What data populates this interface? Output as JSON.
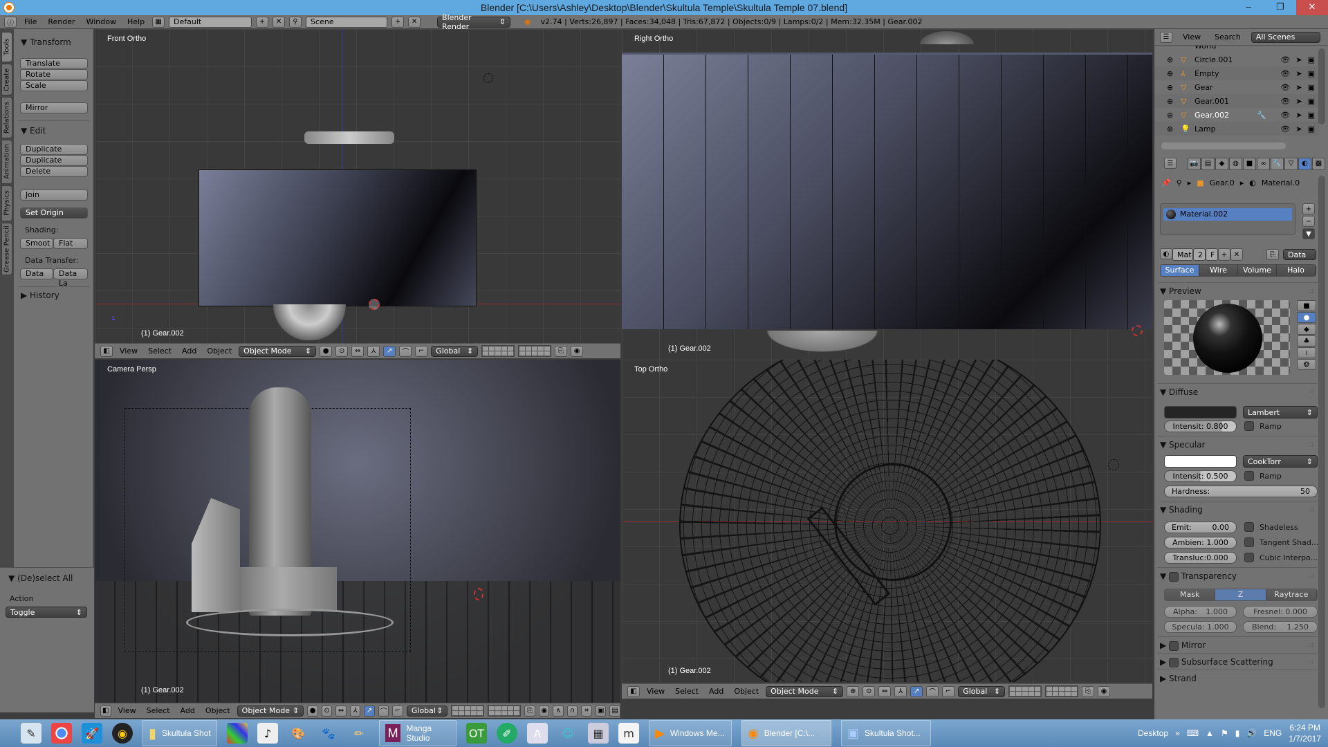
{
  "window": {
    "title": "Blender [C:\\Users\\Ashley\\Desktop\\Blender\\Skultula Temple\\Skultula Temple 07.blend]",
    "controls": {
      "minimize": "–",
      "maximize": "❐",
      "close": "✕"
    }
  },
  "topbar": {
    "menus": [
      "File",
      "Render",
      "Window",
      "Help"
    ],
    "layout": "Default",
    "scene": "Scene",
    "render_engine": "Blender Render",
    "stats": "v2.74 | Verts:26,897 | Faces:34,048 | Tris:67,872 | Objects:0/9 | Lamps:0/2 | Mem:32.35M | Gear.002"
  },
  "toolshelf": {
    "tabs": [
      "Tools",
      "Create",
      "Relations",
      "Animation",
      "Physics",
      "Grease Pencil"
    ],
    "active_tab": "Tools",
    "transform": {
      "title": "Transform",
      "buttons": [
        "Translate",
        "Rotate",
        "Scale",
        "Mirror"
      ]
    },
    "edit": {
      "title": "Edit",
      "buttons": [
        "Duplicate",
        "Duplicate Linked",
        "Delete",
        "Join"
      ],
      "set_origin": "Set Origin"
    },
    "shading": {
      "label": "Shading:",
      "smooth": "Smoot",
      "flat": "Flat"
    },
    "data_transfer": {
      "label": "Data Transfer:",
      "data": "Data",
      "data_layers": "Data La"
    },
    "history": "History"
  },
  "operator": {
    "title": "(De)select All",
    "action_label": "Action",
    "action_value": "Toggle"
  },
  "viewports": [
    {
      "label": "Front Ortho",
      "object": "(1) Gear.002",
      "axes": [
        "z",
        "x"
      ]
    },
    {
      "label": "Right Ortho",
      "object": "(1) Gear.002",
      "axes": [
        "z",
        "y"
      ]
    },
    {
      "label": "Camera Persp",
      "object": "(1) Gear.002",
      "axes": [
        "z",
        "x",
        "y"
      ]
    },
    {
      "label": "Top Ortho",
      "object": "(1) Gear.002",
      "axes": [
        "y",
        "x"
      ]
    }
  ],
  "viewport_header": {
    "menus": [
      "View",
      "Select",
      "Add",
      "Object"
    ],
    "mode": "Object Mode",
    "orientation": "Global"
  },
  "outliner": {
    "menus": [
      "View",
      "Search"
    ],
    "filter": "All Scenes",
    "partial_row": "World",
    "items": [
      {
        "name": "Circle.001",
        "icon": "mesh-icon",
        "selected": false
      },
      {
        "name": "Empty",
        "icon": "empty-icon",
        "selected": false
      },
      {
        "name": "Gear",
        "icon": "mesh-icon",
        "selected": false
      },
      {
        "name": "Gear.001",
        "icon": "mesh-icon",
        "selected": false
      },
      {
        "name": "Gear.002",
        "icon": "mesh-icon",
        "selected": true
      },
      {
        "name": "Lamp",
        "icon": "lamp-icon",
        "selected": false
      }
    ]
  },
  "properties": {
    "breadcrumb": [
      "Gear.0",
      "Material.0"
    ],
    "material_slot": "Material.002",
    "mat_name": "Mat",
    "users": "2",
    "fake": "F",
    "link": "Data",
    "type_tabs": [
      "Surface",
      "Wire",
      "Volume",
      "Halo"
    ],
    "active_type": "Surface",
    "preview": {
      "title": "Preview"
    },
    "diffuse": {
      "title": "Diffuse",
      "color": "#252525",
      "shader": "Lambert",
      "intensity_label": "Intensit:",
      "intensity": "0.800",
      "intensity_fraction": 0.8,
      "ramp": "Ramp"
    },
    "specular": {
      "title": "Specular",
      "color": "#ffffff",
      "shader": "CookTorr",
      "intensity_label": "Intensit:",
      "intensity": "0.500",
      "intensity_fraction": 0.5,
      "ramp": "Ramp",
      "hardness_label": "Hardness:",
      "hardness": "50"
    },
    "shading": {
      "title": "Shading",
      "emit_label": "Emit:",
      "emit": "0.00",
      "ambient_label": "Ambien:",
      "ambient": "1.000",
      "transluc_label": "Transluc:",
      "transluc": "0.000",
      "shadeless": "Shadeless",
      "tangent": "Tangent Shad...",
      "cubic": "Cubic Interpo..."
    },
    "transparency": {
      "title": "Transparency",
      "modes": [
        "Mask",
        "Z Transpare...",
        "Raytrace"
      ],
      "active_mode": "Z Transpare...",
      "alpha_label": "Alpha:",
      "alpha": "1.000",
      "fresnel_label": "Fresnel:",
      "fresnel": "0.000",
      "specula_label": "Specula:",
      "specula": "1.000",
      "blend_label": "Blend:",
      "blend": "1.250"
    },
    "collapsed_panels": [
      "Mirror",
      "Subsurface Scattering",
      "Strand"
    ]
  },
  "taskbar": {
    "apps": [
      {
        "label": "Skultula Shot",
        "icon": "folder-icon"
      },
      {
        "label": "Manga Studio",
        "icon": "manga-studio-icon"
      },
      {
        "label": "Windows Me...",
        "icon": "media-player-icon"
      },
      {
        "label": "Blender [C:\\...",
        "icon": "blender-icon",
        "active": true
      },
      {
        "label": "Skultula Shot...",
        "icon": "photo-viewer-icon"
      }
    ],
    "desktop": "Desktop",
    "language": "ENG",
    "time": "6:24 PM",
    "date": "1/7/2017"
  }
}
